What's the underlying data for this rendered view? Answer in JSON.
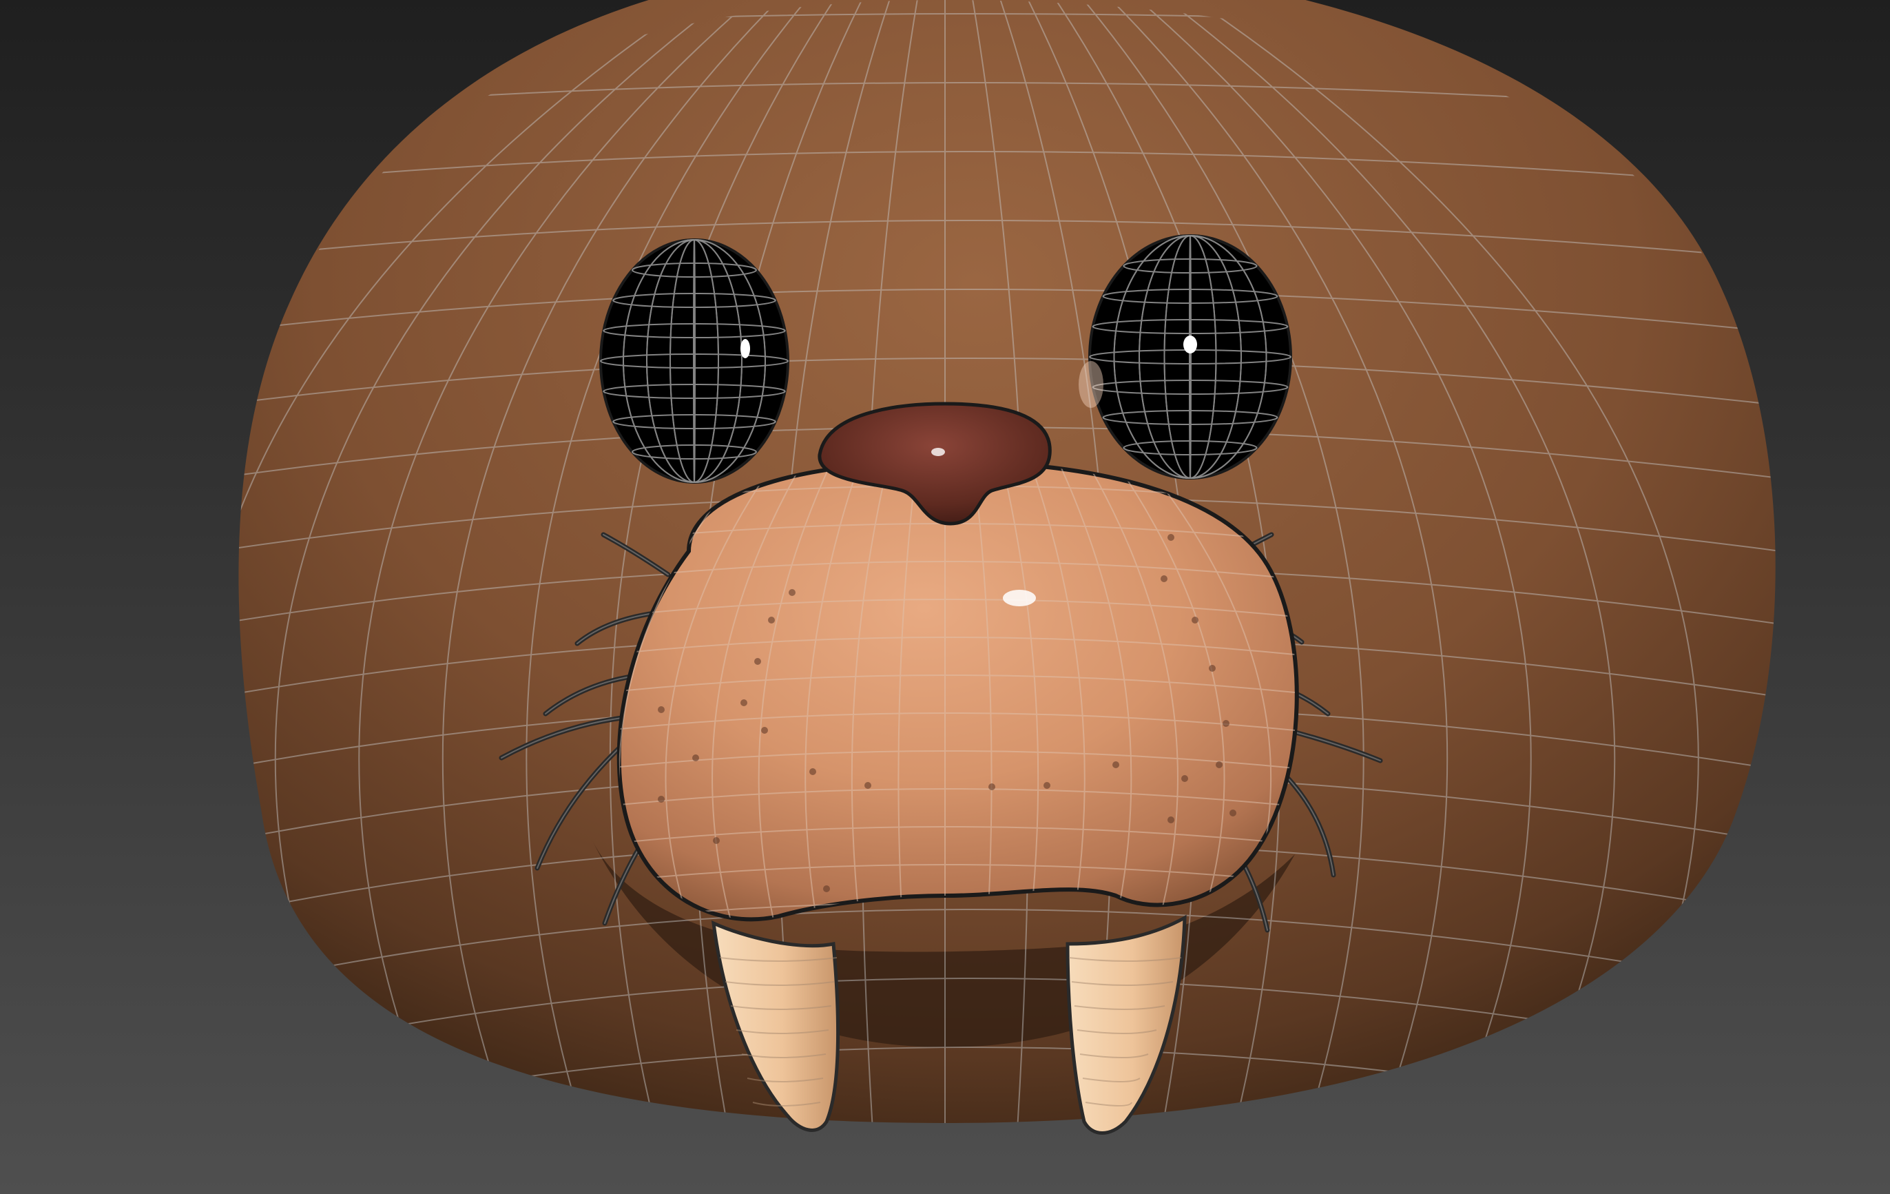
{
  "viewport": {
    "background_top": "#1f1f1f",
    "background_bottom": "#4f4f4f",
    "wireframe_color": "#c9c9c9"
  },
  "model": {
    "subject": "walrus head",
    "head_color": "#8a5a3a",
    "head_shadow": "#3e2718",
    "muzzle_color": "#d99b74",
    "nose_color": "#6a3127",
    "eye_color": "#000000",
    "tusk_color": "#f0c9a0",
    "whisker_color": "#2a2a2a"
  }
}
